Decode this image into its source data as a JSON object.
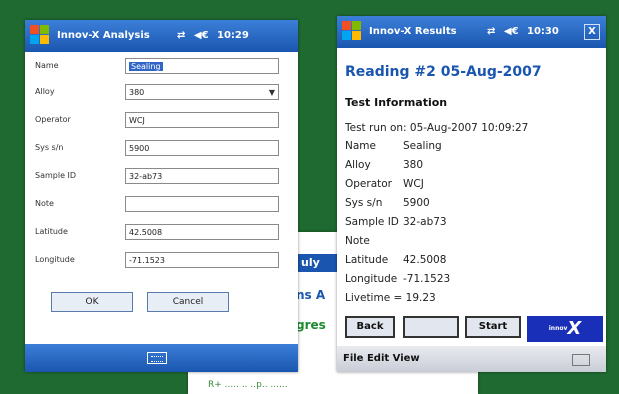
{
  "middle_window": {
    "title_fragment": "uly",
    "subtitle_fragment": "ns A",
    "progress_fragment": "gres",
    "bottom_text": "R+ ..... .. ..p.. ......"
  },
  "left_window": {
    "title": "Innov-X Analysis",
    "status": {
      "signal": "⇄",
      "volume": "◀€",
      "time": "10:29"
    },
    "fields": [
      {
        "label": "Name",
        "value": "Sealing",
        "type": "text",
        "selected": true
      },
      {
        "label": "Alloy",
        "value": "380",
        "type": "select"
      },
      {
        "label": "Operator",
        "value": "WCJ",
        "type": "text"
      },
      {
        "label": "Sys s/n",
        "value": "5900",
        "type": "text"
      },
      {
        "label": "Sample ID",
        "value": "32-ab73",
        "type": "text"
      },
      {
        "label": "Note",
        "value": "",
        "type": "text"
      },
      {
        "label": "Latitude",
        "value": "42.5008",
        "type": "text"
      },
      {
        "label": "Longitude",
        "value": "-71.1523",
        "type": "text"
      }
    ],
    "ok_label": "OK",
    "cancel_label": "Cancel"
  },
  "right_window": {
    "title": "Innov-X Results",
    "status": {
      "signal": "⇄",
      "volume": "◀€",
      "time": "10:30"
    },
    "close_label": "X",
    "reading_title": "Reading #2 05-Aug-2007",
    "section_heading": "Test Information",
    "test_run": "Test run on: 05-Aug-2007 10:09:27",
    "info": [
      {
        "key": "Name",
        "value": "Sealing"
      },
      {
        "key": "Alloy",
        "value": "380"
      },
      {
        "key": "Operator",
        "value": "WCJ"
      },
      {
        "key": "Sys s/n",
        "value": "5900"
      },
      {
        "key": "Sample ID",
        "value": "32-ab73"
      },
      {
        "key": "Note",
        "value": ""
      },
      {
        "key": "Latitude",
        "value": "42.5008"
      },
      {
        "key": "Longitude",
        "value": "-71.1523"
      }
    ],
    "livetime": "Livetime = 19.23",
    "back_label": "Back",
    "blank_label": "",
    "start_label": "Start",
    "logo_text": "X",
    "logo_small": "innov",
    "menu_text": "File Edit View"
  }
}
